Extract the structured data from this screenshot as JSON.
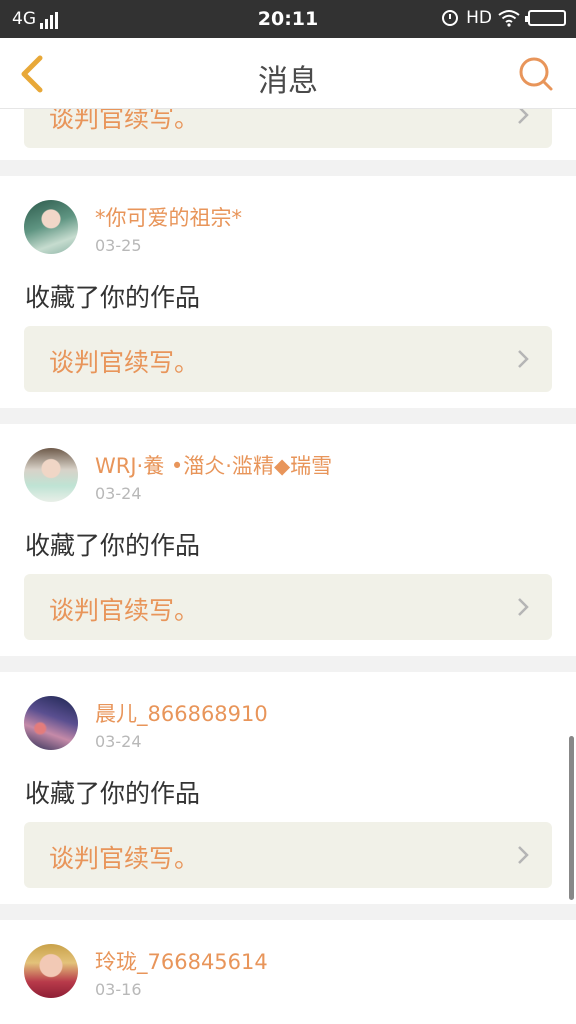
{
  "status_bar": {
    "network": "4G",
    "time": "20:11",
    "hd": "HD"
  },
  "nav": {
    "title": "消息"
  },
  "feed": {
    "top_partial_work_title": "谈判官续写。",
    "items": [
      {
        "user": "*你可爱的祖宗*",
        "date": "03-25",
        "action": "收藏了你的作品",
        "work_title": "谈判官续写。"
      },
      {
        "user": "WRJ·養 •湽仌·滥精◆瑞雪",
        "date": "03-24",
        "action": "收藏了你的作品",
        "work_title": "谈判官续写。"
      },
      {
        "user": "晨儿_866868910",
        "date": "03-24",
        "action": "收藏了你的作品",
        "work_title": "谈判官续写。"
      },
      {
        "user": "玲珑_766845614",
        "date": "03-16"
      }
    ]
  },
  "colors": {
    "accent": "#e8955a",
    "status_bar": "#323232",
    "work_box": "#f1f1e8"
  }
}
